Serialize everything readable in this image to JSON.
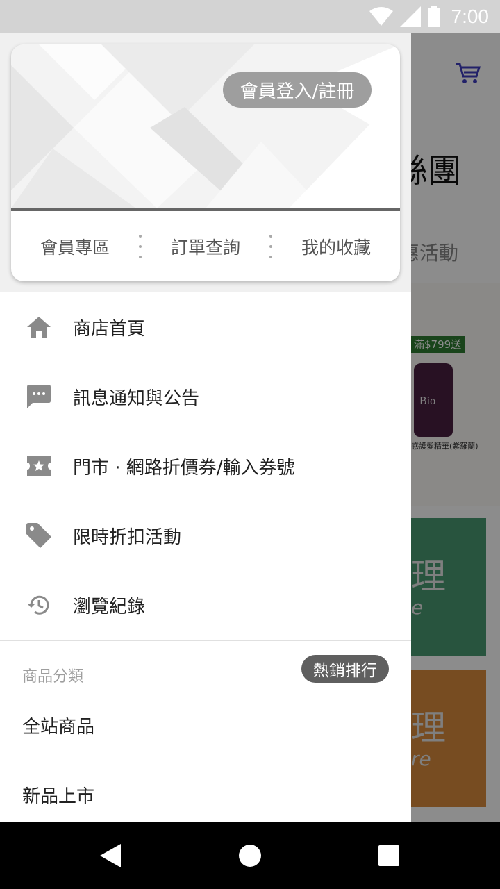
{
  "status_bar": {
    "time": "7:00",
    "icons": [
      "wifi-icon",
      "signal-icon",
      "battery-icon"
    ]
  },
  "background_app": {
    "banner_text": "絲團",
    "promo_text": "惠活動",
    "product": {
      "price_tag": "滿$799送",
      "bottle_label": "Bio",
      "name": "感護髮精華(紫羅蘭)"
    },
    "tiles": [
      {
        "char": "理",
        "sub": "e"
      },
      {
        "char": "理",
        "sub": "re"
      }
    ]
  },
  "drawer": {
    "login_button": "會員登入/註冊",
    "card_links": [
      "會員專區",
      "訂單查詢",
      "我的收藏"
    ],
    "menu_items": [
      {
        "icon": "home-icon",
        "label": "商店首頁"
      },
      {
        "icon": "message-icon",
        "label": "訊息通知與公告"
      },
      {
        "icon": "coupon-icon",
        "label": "門市 · 網路折價券/輸入券號"
      },
      {
        "icon": "tag-icon",
        "label": "限時折扣活動"
      },
      {
        "icon": "history-icon",
        "label": "瀏覽紀錄"
      }
    ],
    "category_heading": "商品分類",
    "hot_badge": "熱銷排行",
    "categories": [
      "全站商品",
      "新品上市"
    ]
  },
  "colors": {
    "accent": "#3f3dbf",
    "icon_gray": "#8a8a8a",
    "badge_gray": "#5f5f5f",
    "green_tag": "#2e7d32"
  }
}
